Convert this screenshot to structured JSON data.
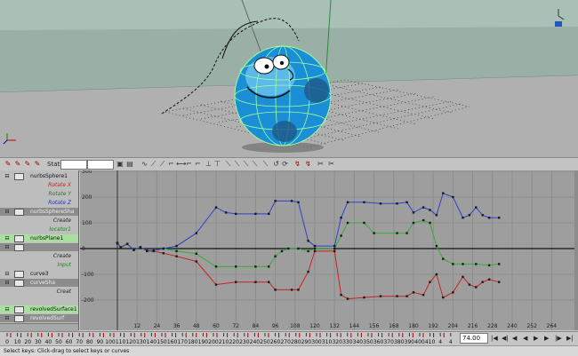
{
  "toolbar": {
    "stats_label": "Stats",
    "icons": [
      "walk-key-icon",
      "insert-key-icon",
      "lattice-icon",
      "spline-tangent-icon",
      "linear-tangent-icon",
      "clamped-tangent-icon",
      "stepped-tangent-icon",
      "flat-tangent-icon",
      "fixed-tangent-icon",
      "break-tangent-icon",
      "unify-tangent-icon",
      "free-weight-icon",
      "lock-weight-icon",
      "infinity-cycle-icon",
      "pre-infinity-icon",
      "post-infinity-icon",
      "buffer-curve-icon",
      "swap-buffer-icon",
      "snapshot-icon"
    ],
    "accent": "#a40000"
  },
  "outliner": {
    "rows": [
      {
        "name": "nurbsSphere1",
        "kind": "object",
        "style": "plain"
      },
      {
        "name": "Rotate X",
        "kind": "channel",
        "color": "#cc2020"
      },
      {
        "name": "Rotate Y",
        "kind": "channel",
        "color": "#208020"
      },
      {
        "name": "Rotate Z",
        "kind": "channel",
        "color": "#2030c0"
      },
      {
        "name": "nurbsSphereSha",
        "kind": "object",
        "style": "dark"
      },
      {
        "name": "Create",
        "kind": "channel",
        "color": "#222222"
      },
      {
        "name": "locator1",
        "kind": "channel",
        "color": "#208020"
      },
      {
        "name": "nurbsPlane1",
        "kind": "object",
        "style": "green"
      },
      {
        "name": "",
        "kind": "object",
        "style": "dark"
      },
      {
        "name": "Create",
        "kind": "channel",
        "color": "#222222"
      },
      {
        "name": "Input",
        "kind": "channel",
        "color": "#208020"
      },
      {
        "name": "curve3",
        "kind": "object",
        "style": "plain"
      },
      {
        "name": "curveSha",
        "kind": "object",
        "style": "dark"
      },
      {
        "name": "Creat",
        "kind": "channel",
        "color": "#222222"
      },
      {
        "name": "",
        "kind": "channel",
        "color": "#208020"
      },
      {
        "name": "revolvedSurface1",
        "kind": "object",
        "style": "green"
      },
      {
        "name": "revolvedSurf",
        "kind": "object",
        "style": "dark"
      }
    ]
  },
  "graph": {
    "y_ticks": [
      "300",
      "200",
      "100",
      "0",
      "-100",
      "-200"
    ],
    "x_ticks": [
      "12",
      "24",
      "36",
      "48",
      "60",
      "72",
      "84",
      "96",
      "108",
      "120",
      "132",
      "144",
      "156",
      "168",
      "180",
      "192",
      "204",
      "216",
      "228",
      "240",
      "252",
      "264"
    ],
    "curves": [
      {
        "name": "Rotate X",
        "color": "#cc2020",
        "points": [
          [
            0,
            22
          ],
          [
            2,
            5
          ],
          [
            6,
            18
          ],
          [
            10,
            -5
          ],
          [
            14,
            5
          ],
          [
            18,
            -10
          ],
          [
            22,
            -10
          ],
          [
            28,
            -18
          ],
          [
            36,
            -30
          ],
          [
            48,
            -50
          ],
          [
            60,
            -140
          ],
          [
            72,
            -130
          ],
          [
            84,
            -130
          ],
          [
            92,
            -130
          ],
          [
            96,
            -160
          ],
          [
            106,
            -160
          ],
          [
            110,
            -160
          ],
          [
            116,
            -90
          ],
          [
            120,
            -10
          ],
          [
            132,
            -10
          ],
          [
            136,
            -180
          ],
          [
            140,
            -195
          ],
          [
            150,
            -190
          ],
          [
            160,
            -185
          ],
          [
            170,
            -185
          ],
          [
            176,
            -185
          ],
          [
            180,
            -170
          ],
          [
            186,
            -180
          ],
          [
            190,
            -130
          ],
          [
            194,
            -100
          ],
          [
            198,
            -190
          ],
          [
            204,
            -170
          ],
          [
            210,
            -110
          ],
          [
            214,
            -140
          ],
          [
            218,
            -150
          ],
          [
            222,
            -130
          ],
          [
            226,
            -120
          ],
          [
            232,
            -130
          ]
        ]
      },
      {
        "name": "Rotate Y",
        "color": "#30b030",
        "points": [
          [
            0,
            20
          ],
          [
            2,
            2
          ],
          [
            6,
            18
          ],
          [
            10,
            -5
          ],
          [
            14,
            5
          ],
          [
            18,
            -8
          ],
          [
            22,
            -8
          ],
          [
            28,
            0
          ],
          [
            36,
            -10
          ],
          [
            48,
            -20
          ],
          [
            60,
            -70
          ],
          [
            72,
            -70
          ],
          [
            84,
            -70
          ],
          [
            92,
            -70
          ],
          [
            96,
            -30
          ],
          [
            100,
            -10
          ],
          [
            104,
            0
          ],
          [
            110,
            0
          ],
          [
            116,
            -10
          ],
          [
            120,
            0
          ],
          [
            132,
            0
          ],
          [
            136,
            50
          ],
          [
            140,
            100
          ],
          [
            150,
            100
          ],
          [
            156,
            60
          ],
          [
            170,
            60
          ],
          [
            176,
            60
          ],
          [
            180,
            100
          ],
          [
            186,
            110
          ],
          [
            190,
            100
          ],
          [
            194,
            10
          ],
          [
            198,
            -40
          ],
          [
            204,
            -60
          ],
          [
            210,
            -60
          ],
          [
            218,
            -60
          ],
          [
            226,
            -65
          ],
          [
            232,
            -60
          ]
        ]
      },
      {
        "name": "Rotate Z",
        "color": "#3040d0",
        "points": [
          [
            0,
            22
          ],
          [
            2,
            5
          ],
          [
            6,
            18
          ],
          [
            10,
            -5
          ],
          [
            14,
            5
          ],
          [
            18,
            -8
          ],
          [
            22,
            -8
          ],
          [
            28,
            0
          ],
          [
            36,
            10
          ],
          [
            48,
            60
          ],
          [
            60,
            160
          ],
          [
            66,
            140
          ],
          [
            72,
            135
          ],
          [
            84,
            135
          ],
          [
            92,
            135
          ],
          [
            96,
            185
          ],
          [
            106,
            185
          ],
          [
            110,
            180
          ],
          [
            116,
            30
          ],
          [
            120,
            10
          ],
          [
            132,
            10
          ],
          [
            136,
            120
          ],
          [
            140,
            180
          ],
          [
            150,
            180
          ],
          [
            160,
            175
          ],
          [
            170,
            175
          ],
          [
            176,
            180
          ],
          [
            180,
            140
          ],
          [
            186,
            160
          ],
          [
            190,
            150
          ],
          [
            194,
            130
          ],
          [
            198,
            215
          ],
          [
            204,
            200
          ],
          [
            210,
            120
          ],
          [
            214,
            130
          ],
          [
            218,
            160
          ],
          [
            222,
            130
          ],
          [
            226,
            120
          ],
          [
            232,
            120
          ]
        ]
      }
    ]
  },
  "timeline": {
    "ticks": [
      "0",
      "10",
      "20",
      "30",
      "40",
      "50",
      "60",
      "70",
      "80",
      "90",
      "100",
      "110",
      "120",
      "130",
      "140",
      "150",
      "160",
      "170",
      "180",
      "190",
      "200",
      "210",
      "220",
      "230",
      "240",
      "250",
      "260",
      "270",
      "280",
      "290",
      "300",
      "310",
      "320",
      "330",
      "340",
      "350",
      "360",
      "370",
      "380",
      "390",
      "400",
      "410",
      "4",
      "4"
    ],
    "current_frame": "74.00"
  },
  "help": {
    "text": "Select keys: Click-drag to select keys or curves"
  }
}
